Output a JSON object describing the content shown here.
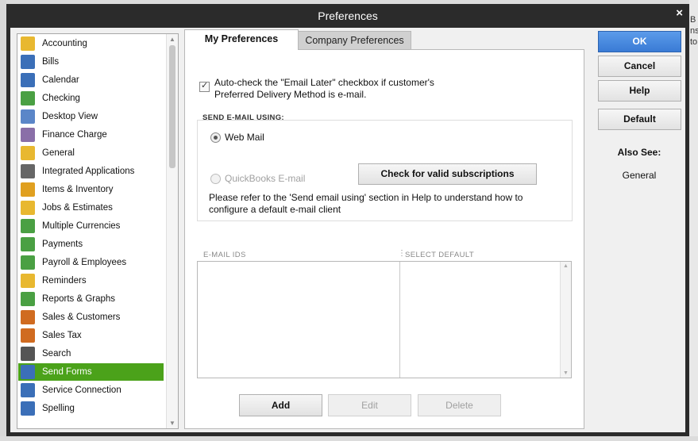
{
  "window": {
    "title": "Preferences",
    "close_glyph": "×"
  },
  "background": {
    "right_edge_text": [
      "B",
      "ns",
      "to"
    ]
  },
  "categories": [
    {
      "label": "Accounting",
      "icon": "accounting-icon",
      "color": "#e8b830"
    },
    {
      "label": "Bills",
      "icon": "bills-icon",
      "color": "#3b6fb8"
    },
    {
      "label": "Calendar",
      "icon": "calendar-icon",
      "color": "#3b6fb8"
    },
    {
      "label": "Checking",
      "icon": "checking-icon",
      "color": "#4aa043"
    },
    {
      "label": "Desktop View",
      "icon": "desktop-view-icon",
      "color": "#5b86c8"
    },
    {
      "label": "Finance Charge",
      "icon": "finance-charge-icon",
      "color": "#8a6fa8"
    },
    {
      "label": "General",
      "icon": "general-icon",
      "color": "#e8b830"
    },
    {
      "label": "Integrated Applications",
      "icon": "integrated-applications-icon",
      "color": "#666666"
    },
    {
      "label": "Items & Inventory",
      "icon": "items-inventory-icon",
      "color": "#e0a020"
    },
    {
      "label": "Jobs & Estimates",
      "icon": "jobs-estimates-icon",
      "color": "#e8b830"
    },
    {
      "label": "Multiple Currencies",
      "icon": "multiple-currencies-icon",
      "color": "#4aa043"
    },
    {
      "label": "Payments",
      "icon": "payments-icon",
      "color": "#4aa043"
    },
    {
      "label": "Payroll & Employees",
      "icon": "payroll-employees-icon",
      "color": "#4aa043"
    },
    {
      "label": "Reminders",
      "icon": "reminders-icon",
      "color": "#e8b830"
    },
    {
      "label": "Reports & Graphs",
      "icon": "reports-graphs-icon",
      "color": "#4aa043"
    },
    {
      "label": "Sales & Customers",
      "icon": "sales-customers-icon",
      "color": "#d06b20"
    },
    {
      "label": "Sales Tax",
      "icon": "sales-tax-icon",
      "color": "#d06b20"
    },
    {
      "label": "Search",
      "icon": "search-icon",
      "color": "#555555"
    },
    {
      "label": "Send Forms",
      "icon": "send-forms-icon",
      "color": "#3b6fb8"
    },
    {
      "label": "Service Connection",
      "icon": "service-connection-icon",
      "color": "#3b6fb8"
    },
    {
      "label": "Spelling",
      "icon": "spelling-icon",
      "color": "#3b6fb8"
    }
  ],
  "selected_category": "Send Forms",
  "tabs": {
    "my": "My Preferences",
    "company": "Company Preferences"
  },
  "my_prefs": {
    "auto_check_label": "Auto-check the \"Email Later\" checkbox if customer's Preferred Delivery Method is e-mail.",
    "auto_check_checked": true,
    "send_group_label": "SEND E-MAIL USING:",
    "web_mail_label": "Web Mail",
    "web_mail_selected": true,
    "qb_email_label": "QuickBooks E-mail",
    "check_button": "Check for valid subscriptions",
    "note": "Please refer to the 'Send email using' section in Help to understand how to configure a default e-mail client",
    "col_email_ids": "E-MAIL IDS",
    "col_select_default": "SELECT DEFAULT",
    "add_button": "Add",
    "edit_button": "Edit",
    "delete_button": "Delete"
  },
  "side_buttons": {
    "ok": "OK",
    "cancel": "Cancel",
    "help": "Help",
    "default": "Default"
  },
  "also_see": {
    "title": "Also See:",
    "link": "General"
  },
  "colors": {
    "selected_green": "#4ba21a",
    "primary_blue": "#3a7bd5",
    "title_bar": "#2b2b2b"
  }
}
